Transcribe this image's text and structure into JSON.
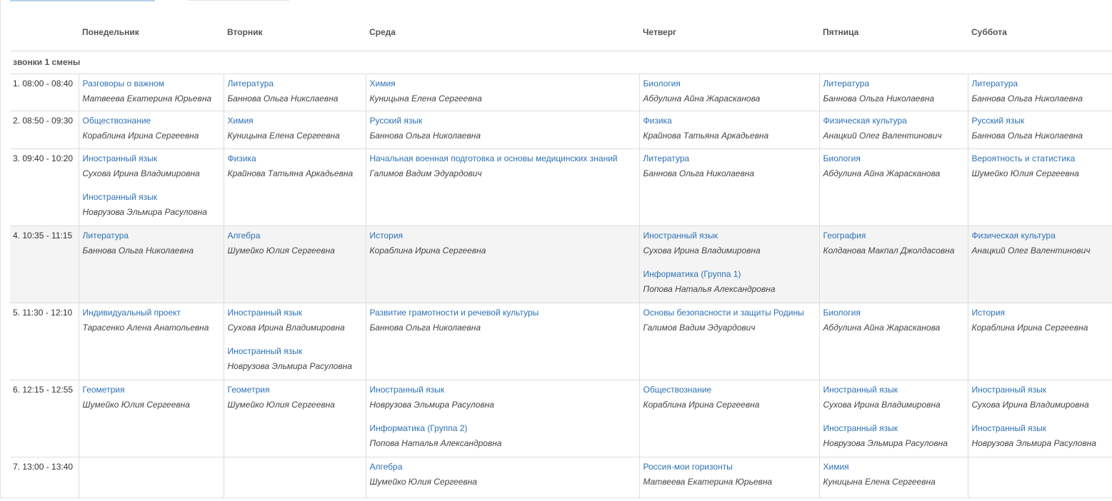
{
  "days": [
    "Понедельник",
    "Вторник",
    "Среда",
    "Четверг",
    "Пятница",
    "Суббота"
  ],
  "shift_title": "звонки 1 смены",
  "rows": [
    {
      "time": "1. 08:00 - 08:40",
      "cells": [
        [
          {
            "subject": "Разговоры о важном",
            "teacher": "Матвеева Екатерина Юрьевна"
          }
        ],
        [
          {
            "subject": "Литература",
            "teacher": "Баннова Ольга Никслаевна"
          }
        ],
        [
          {
            "subject": "Химия",
            "teacher": "Куницына Елена Сергеевна"
          }
        ],
        [
          {
            "subject": "Биология",
            "teacher": "Абдулина Айна Жарасканова"
          }
        ],
        [
          {
            "subject": "Литература",
            "teacher": "Баннова Ольга Николаевна"
          }
        ],
        [
          {
            "subject": "Литература",
            "teacher": "Баннова Ольга Николаевна"
          }
        ]
      ]
    },
    {
      "time": "2. 08:50 - 09:30",
      "cells": [
        [
          {
            "subject": "Обществознание",
            "teacher": "Кораблина Ирина Сергеевна"
          }
        ],
        [
          {
            "subject": "Химия",
            "teacher": "Куницына Елена Сергеевна"
          }
        ],
        [
          {
            "subject": "Русский язык",
            "teacher": "Баннова Ольга Николаевна"
          }
        ],
        [
          {
            "subject": "Физика",
            "teacher": "Крайнова Татьяна Аркадьевна"
          }
        ],
        [
          {
            "subject": "Физическая культура",
            "teacher": "Анацкий Олег Валентинович"
          }
        ],
        [
          {
            "subject": "Русский язык",
            "teacher": "Баннова Ольга Николаевна"
          }
        ]
      ]
    },
    {
      "time": "3. 09:40 - 10:20",
      "cells": [
        [
          {
            "subject": "Иностранный язык",
            "teacher": "Сухова Ирина Владимировна"
          },
          {
            "subject": "Иностранный язык",
            "teacher": "Новрузова Эльмира Расуловна"
          }
        ],
        [
          {
            "subject": "Физика",
            "teacher": "Крайнова Татьяна Аркадьевна"
          }
        ],
        [
          {
            "subject": "Начальная военная подготовка и основы медицинских знаний",
            "teacher": "Галимов Вадим Эдуардович"
          }
        ],
        [
          {
            "subject": "Литература",
            "teacher": "Баннова Ольга Николаевна"
          }
        ],
        [
          {
            "subject": "Биология",
            "teacher": "Абдулина Айна Жарасканова"
          }
        ],
        [
          {
            "subject": "Вероятность и статистика",
            "teacher": "Шумейко Юлия Сергеевна"
          }
        ]
      ]
    },
    {
      "time": "4. 10:35 - 11:15",
      "cells": [
        [
          {
            "subject": "Литература",
            "teacher": "Баннова Ольга Николаевна"
          }
        ],
        [
          {
            "subject": "Алгебра",
            "teacher": "Шумейко Юлия Сергеевна"
          }
        ],
        [
          {
            "subject": "История",
            "teacher": "Кораблина Ирина Сергеевна"
          }
        ],
        [
          {
            "subject": "Иностранный язык",
            "teacher": "Сухова Ирина Владимировна"
          },
          {
            "subject": "Информатика (Группа 1)",
            "teacher": "Попова Наталья Александровна"
          }
        ],
        [
          {
            "subject": "География",
            "teacher": "Колданова Макпал Джолдасовна"
          }
        ],
        [
          {
            "subject": "Физическая культура",
            "teacher": "Анацкий Олег Валентинович"
          }
        ]
      ]
    },
    {
      "time": "5. 11:30 - 12:10",
      "cells": [
        [
          {
            "subject": "Индивидуальный проект",
            "teacher": "Тарасенко Алена Анатольевна"
          }
        ],
        [
          {
            "subject": "Иностранный язык",
            "teacher": "Сухова Ирина Владимировна"
          },
          {
            "subject": "Иностранный язык",
            "teacher": "Новрузова Эльмира Расуловна"
          }
        ],
        [
          {
            "subject": "Развитие грамотности и речевой культуры",
            "teacher": "Баннова Ольга Николаевна"
          }
        ],
        [
          {
            "subject": "Основы безопасности и защиты Родины",
            "teacher": "Галимов Вадим Эдуардович"
          }
        ],
        [
          {
            "subject": "Биология",
            "teacher": "Абдулина Айна Жарасканова"
          }
        ],
        [
          {
            "subject": "История",
            "teacher": "Кораблина Ирина Сергеевна"
          }
        ]
      ]
    },
    {
      "time": "6. 12:15 - 12:55",
      "cells": [
        [
          {
            "subject": "Геометрия",
            "teacher": "Шумейко Юлия Сергеевна"
          }
        ],
        [
          {
            "subject": "Геометрия",
            "teacher": "Шумейко Юлия Сергеевна"
          }
        ],
        [
          {
            "subject": "Иностранный язык",
            "teacher": "Новрузова Эльмира Расуловна"
          },
          {
            "subject": "Информатика (Группа 2)",
            "teacher": "Попова Наталья Александровна"
          }
        ],
        [
          {
            "subject": "Обществознание",
            "teacher": "Кораблина Ирина Сергеевна"
          }
        ],
        [
          {
            "subject": "Иностранный язык",
            "teacher": "Сухова Ирина Владимировна"
          },
          {
            "subject": "Иностранный язык",
            "teacher": "Новрузова Эльмира Расуловна"
          }
        ],
        [
          {
            "subject": "Иностранный язык",
            "teacher": "Сухова Ирина Владимировна"
          },
          {
            "subject": "Иностранный язык",
            "teacher": "Новрузова Эльмира Расуловна"
          }
        ]
      ]
    },
    {
      "time": "7. 13:00 - 13:40",
      "cells": [
        [],
        [],
        [
          {
            "subject": "Алгебра",
            "teacher": "Шумейко Юлия Сергеевна"
          }
        ],
        [
          {
            "subject": "Россия-мои горизонты",
            "teacher": "Матвеева Екатерина Юрьевна"
          }
        ],
        [
          {
            "subject": "Химия",
            "teacher": "Куницына Елена Сергеевна"
          }
        ],
        []
      ]
    }
  ]
}
